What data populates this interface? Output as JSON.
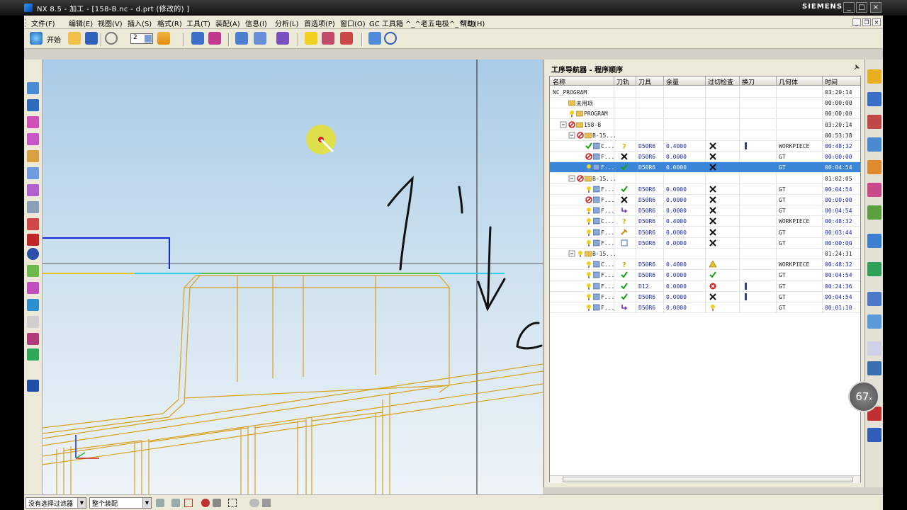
{
  "window": {
    "title": "NX 8.5 - 加工 - [158-B.nc - d.prt (修改的) ]",
    "brand": "SIEMENS"
  },
  "menu": [
    "文件(F)",
    "编辑(E)",
    "视图(V)",
    "插入(S)",
    "格式(R)",
    "工具(T)",
    "装配(A)",
    "信息(I)",
    "分析(L)",
    "首选项(P)",
    "窗口(O)",
    "GC 工具箱",
    "^_^老五电极^_^(D)",
    "帮助(H)"
  ],
  "toolbar": {
    "start_label": "开始",
    "layer_value": "2"
  },
  "navigator": {
    "title": "工序导航器 - 程序顺序",
    "columns": [
      "名称",
      "刀轨",
      "刀具",
      "余量",
      "过切检查",
      "换刀",
      "几何体",
      "时间"
    ],
    "rows": [
      {
        "name": "NC_PROGRAM",
        "tool": "",
        "stock": "",
        "geometry": "",
        "time": "03:20:14"
      },
      {
        "name": "未用项",
        "tool": "",
        "stock": "",
        "geometry": "",
        "time": "00:00:00"
      },
      {
        "name": "PROGRAM",
        "tool": "",
        "stock": "",
        "geometry": "",
        "time": "00:00:00"
      },
      {
        "name": "158-B",
        "tool": "",
        "stock": "",
        "geometry": "",
        "time": "03:20:14"
      },
      {
        "name": "B-15...",
        "tool": "",
        "stock": "",
        "geometry": "",
        "time": "00:53:38"
      },
      {
        "name": "C...",
        "tool": "D50R6",
        "stock": "0.4000",
        "geometry": "WORKPIECE",
        "time": "00:48:32"
      },
      {
        "name": "F...",
        "tool": "D50R6",
        "stock": "0.0000",
        "geometry": "GT",
        "time": "00:00:00"
      },
      {
        "name": "F...",
        "tool": "D50R6",
        "stock": "0.0000",
        "geometry": "GT",
        "time": "00:04:54"
      },
      {
        "name": "B-15...",
        "tool": "",
        "stock": "",
        "geometry": "",
        "time": "01:02:05"
      },
      {
        "name": "F...",
        "tool": "D50R6",
        "stock": "0.0000",
        "geometry": "GT",
        "time": "00:04:54"
      },
      {
        "name": "F...",
        "tool": "D50R6",
        "stock": "0.0000",
        "geometry": "GT",
        "time": "00:00:00"
      },
      {
        "name": "F...",
        "tool": "D50R6",
        "stock": "0.0000",
        "geometry": "GT",
        "time": "00:04:54"
      },
      {
        "name": "C...",
        "tool": "D50R6",
        "stock": "0.4000",
        "geometry": "WORKPIECE",
        "time": "00:48:32"
      },
      {
        "name": "F...",
        "tool": "D50R6",
        "stock": "0.0000",
        "geometry": "GT",
        "time": "00:03:44"
      },
      {
        "name": "F...",
        "tool": "D50R6",
        "stock": "0.0000",
        "geometry": "GT",
        "time": "00:00:00"
      },
      {
        "name": "B-15...",
        "tool": "",
        "stock": "",
        "geometry": "",
        "time": "01:24:31"
      },
      {
        "name": "C...",
        "tool": "D50R6",
        "stock": "0.4000",
        "geometry": "WORKPIECE",
        "time": "00:48:32"
      },
      {
        "name": "F...",
        "tool": "D50R6",
        "stock": "0.0000",
        "geometry": "GT",
        "time": "00:04:54"
      },
      {
        "name": "F...",
        "tool": "D12",
        "stock": "0.0000",
        "geometry": "GT",
        "time": "00:24:36"
      },
      {
        "name": "F...",
        "tool": "D50R6",
        "stock": "0.0000",
        "geometry": "GT",
        "time": "00:04:54"
      },
      {
        "name": "F...",
        "tool": "D50R6",
        "stock": "0.0000",
        "geometry": "GT",
        "time": "00:01:10"
      }
    ]
  },
  "zoom": {
    "value": "67",
    "unit": "x"
  },
  "status": {
    "filter_label": "没有选择过滤器",
    "assembly_label": "整个装配"
  },
  "colors": {
    "selection": "#3a86d8",
    "wireframe": "#d9a01a",
    "sketch": "#1a2ad8",
    "ink": "#111111"
  }
}
